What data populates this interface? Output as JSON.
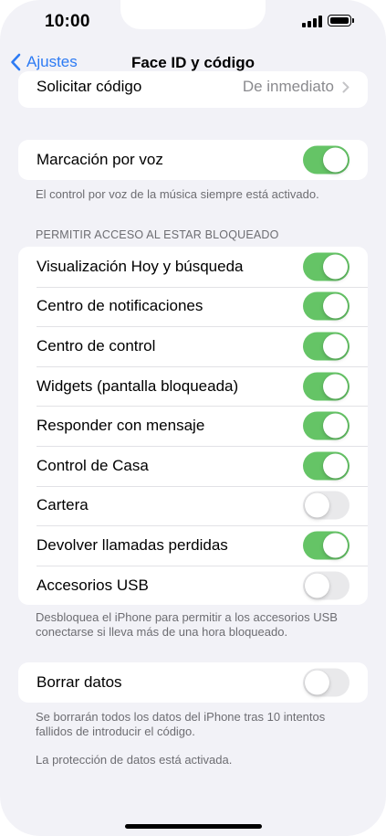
{
  "status_bar": {
    "time": "10:00"
  },
  "nav": {
    "back_label": "Ajustes",
    "title": "Face ID y código"
  },
  "require_code": {
    "label": "Solicitar código",
    "value": "De inmediato"
  },
  "voice_dial": {
    "label": "Marcación por voz",
    "on": true,
    "footer": "El control por voz de la música siempre está activado."
  },
  "locked_access": {
    "header": "PERMITIR ACCESO AL ESTAR BLOQUEADO",
    "items": [
      {
        "label": "Visualización Hoy y búsqueda",
        "on": true
      },
      {
        "label": "Centro de notificaciones",
        "on": true
      },
      {
        "label": "Centro de control",
        "on": true
      },
      {
        "label": "Widgets (pantalla bloqueada)",
        "on": true
      },
      {
        "label": "Responder con mensaje",
        "on": true
      },
      {
        "label": "Control de Casa",
        "on": true
      },
      {
        "label": "Cartera",
        "on": false
      },
      {
        "label": "Devolver llamadas perdidas",
        "on": true
      },
      {
        "label": "Accesorios USB",
        "on": false
      }
    ],
    "footer": "Desbloquea el iPhone para permitir a los accesorios USB conectarse si lleva más de una hora bloqueado."
  },
  "erase_data": {
    "label": "Borrar datos",
    "on": false,
    "footer": "Se borrarán todos los datos del iPhone tras 10 intentos fallidos de introducir el código.",
    "protection": "La protección de datos está activada."
  },
  "colors": {
    "accent": "#2d7bf4",
    "toggle_on": "#65c466",
    "toggle_off": "#e9e9eb"
  }
}
